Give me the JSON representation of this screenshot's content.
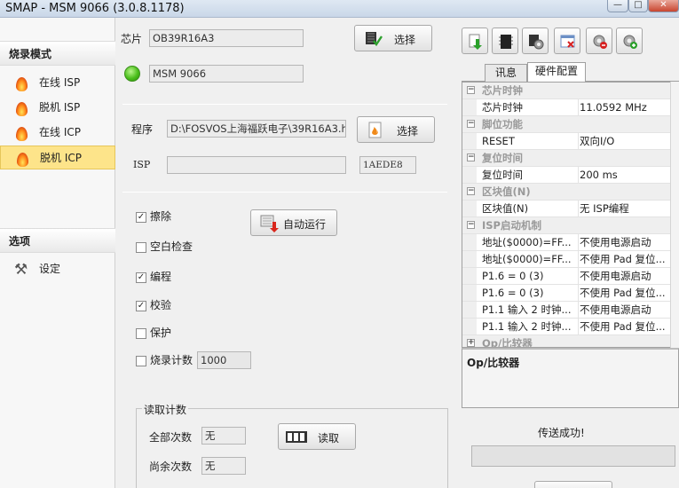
{
  "window": {
    "title": "SMAP - MSM 9066  (3.0.8.1178)",
    "min_label": "—",
    "max_label": "□",
    "close_label": "✕"
  },
  "sidebar": {
    "section1_title": "烧录模式",
    "items": [
      {
        "label": "在线 ISP",
        "icon": "flame-icon"
      },
      {
        "label": "脱机 ISP",
        "icon": "flame-icon"
      },
      {
        "label": "在线 ICP",
        "icon": "flame-icon"
      },
      {
        "label": "脱机 ICP",
        "icon": "flame-icon",
        "active": true
      }
    ],
    "section2_title": "选项",
    "options": [
      {
        "label": "设定",
        "icon": "tools-icon"
      }
    ]
  },
  "chip": {
    "label": "芯片",
    "value": "OB39R16A3",
    "select_label": "选择",
    "device": "MSM 9066",
    "status_color": "#4bbf1c"
  },
  "program": {
    "label": "程序",
    "path": "D:\\FOSVOS上海福跃电子\\39R16A3.h",
    "select_label": "选择",
    "isp_label": "ISP",
    "isp_value": "",
    "checksum": "1AEDE8"
  },
  "operations": {
    "erase": {
      "label": "擦除",
      "checked": true
    },
    "blank_check": {
      "label": "空白检查",
      "checked": false
    },
    "program": {
      "label": "编程",
      "checked": true
    },
    "verify": {
      "label": "校验",
      "checked": true
    },
    "protect": {
      "label": "保护",
      "checked": false
    },
    "burn_count": {
      "label": "烧录计数",
      "checked": false,
      "value": "1000"
    },
    "auto_run_label": "自动运行"
  },
  "read_count": {
    "title": "读取计数",
    "total_label": "全部次数",
    "total_value": "无",
    "remaining_label": "尚余次数",
    "remaining_value": "无",
    "read_label": "读取"
  },
  "tabs": [
    {
      "label": "讯息",
      "selected": false
    },
    {
      "label": "硬件配置",
      "selected": true
    }
  ],
  "properties": [
    {
      "category": "芯片时钟"
    },
    {
      "key": "芯片时钟",
      "value": "11.0592 MHz"
    },
    {
      "category": "脚位功能"
    },
    {
      "key": "RESET",
      "value": "双向I/O"
    },
    {
      "category": "复位时间"
    },
    {
      "key": "复位时间",
      "value": "200 ms"
    },
    {
      "category": "区块值(N)"
    },
    {
      "key": "区块值(N)",
      "value": "无 ISP编程"
    },
    {
      "category": "ISP启动机制"
    },
    {
      "key": "地址($0000)=FF...",
      "value": "不使用电源启动"
    },
    {
      "key": "地址($0000)=FF...",
      "value": "不使用 Pad 复位..."
    },
    {
      "key": "P1.6 = 0 (3)",
      "value": "不使用电源启动"
    },
    {
      "key": "P1.6 = 0 (3)",
      "value": "不使用 Pad 复位..."
    },
    {
      "key": "P1.1 输入 2 时钟...",
      "value": "不使用电源启动"
    },
    {
      "key": "P1.1 输入 2 时钟...",
      "value": "不使用 Pad 复位..."
    },
    {
      "category": "Op/比较器"
    }
  ],
  "description": {
    "title": "Op/比较器"
  },
  "status": {
    "message": "传送成功!",
    "progress": 0
  }
}
